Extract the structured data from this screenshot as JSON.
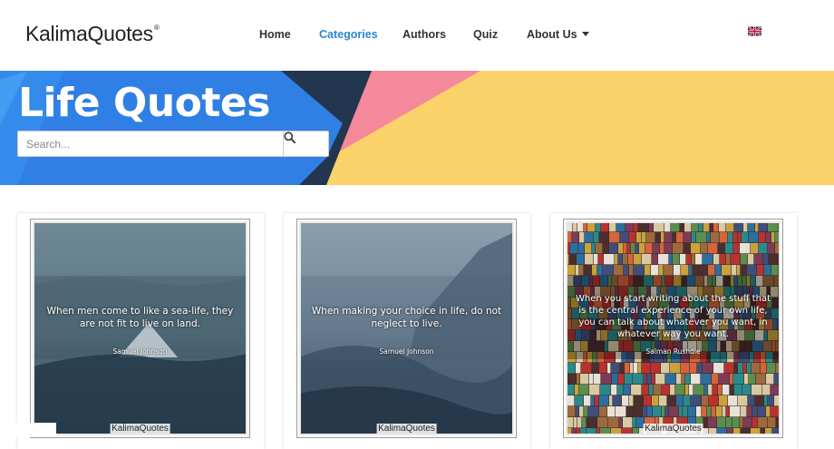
{
  "header": {
    "logo_prefix": "Kalima",
    "logo_suffix": "Quotes",
    "logo_mark": "®",
    "nav": [
      {
        "label": "Home",
        "active": false
      },
      {
        "label": "Categories",
        "active": true
      },
      {
        "label": "Authors",
        "active": false
      },
      {
        "label": "Quiz",
        "active": false
      },
      {
        "label": "About Us",
        "active": false,
        "dropdown": true
      }
    ],
    "language_icon": "uk-flag-icon"
  },
  "hero": {
    "title": "Life Quotes",
    "search": {
      "placeholder": "Search...",
      "value": "",
      "icon": "search-icon"
    },
    "colors": {
      "blue": "#2f7fe4",
      "dark_navy": "#22364f",
      "pink": "#f3899a",
      "yellow": "#fcd26a"
    }
  },
  "cards": [
    {
      "quote": "When men come to like a sea-life, they are not fit to live on land.",
      "author": "Samuel Johnson",
      "watermark_prefix": "Kalima",
      "watermark_suffix": "Quotes"
    },
    {
      "quote": "When making your choice in life, do not neglect to live.",
      "author": "Samuel Johnson",
      "watermark_prefix": "Kalima",
      "watermark_suffix": "Quotes"
    },
    {
      "quote": "When you start writing about the stuff that is the central experience of your own life, you can talk about whatever you want, in whatever way you want.",
      "author": "Salman Rushdie",
      "watermark_prefix": "Kalima",
      "watermark_suffix": "Quotes"
    }
  ]
}
